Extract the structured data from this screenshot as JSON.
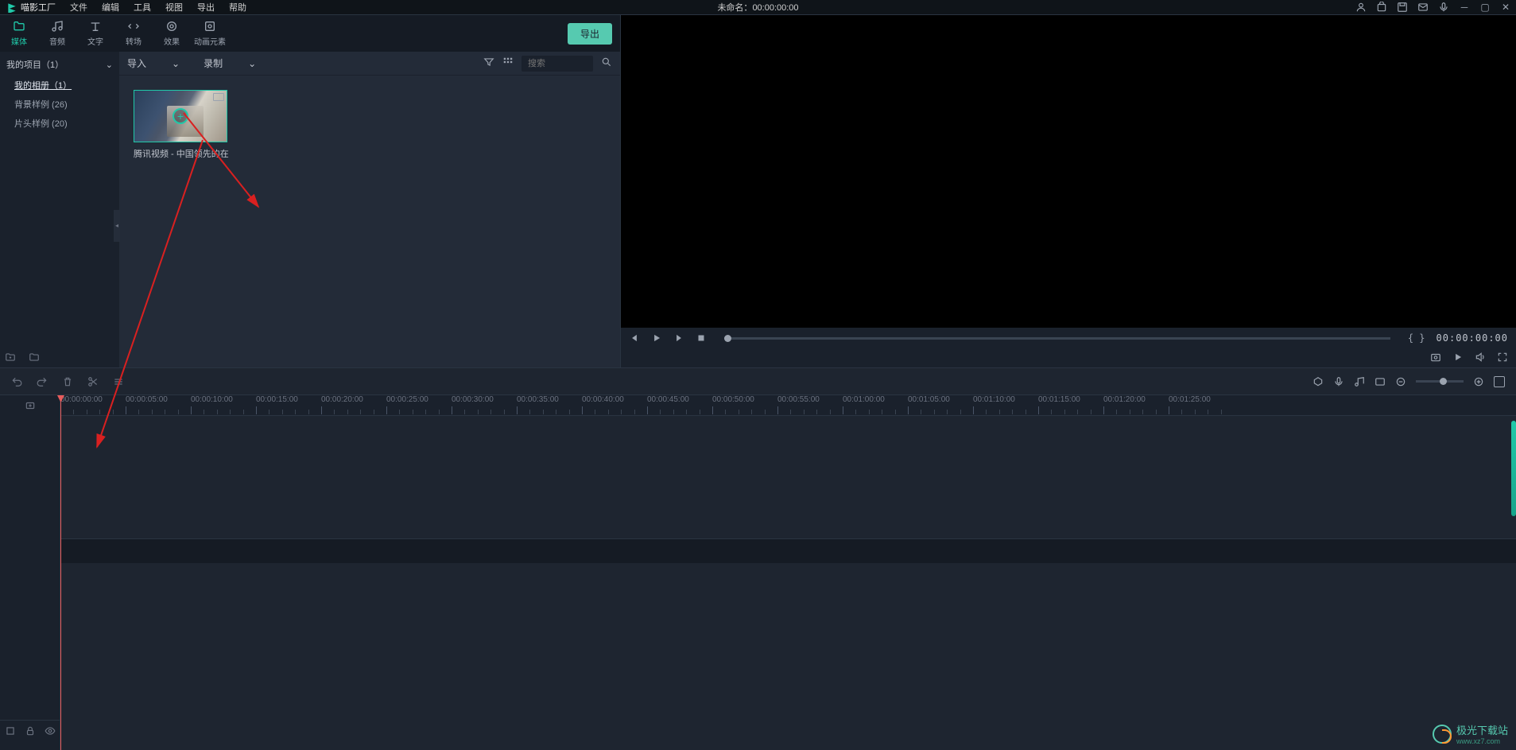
{
  "app": {
    "name": "喵影工厂"
  },
  "menubar": [
    "文件",
    "编辑",
    "工具",
    "视图",
    "导出",
    "帮助"
  ],
  "title_center": {
    "doc": "未命名：",
    "time": "00:00:00:00"
  },
  "tabs": {
    "media": "媒体",
    "audio": "音频",
    "text": "文字",
    "transition": "转场",
    "effect": "效果",
    "element": "动画元素"
  },
  "export_label": "导出",
  "sidebar": {
    "project_header": "我的项目（1）",
    "items": [
      {
        "label": "我的相册（1）",
        "active": true
      },
      {
        "label": "背景样例  (26)",
        "active": false
      },
      {
        "label": "片头样例  (20)",
        "active": false
      }
    ]
  },
  "browser": {
    "import_label": "导入",
    "record_label": "录制",
    "search_placeholder": "搜索"
  },
  "media_clip": {
    "label": "腾讯视频 - 中国领先的在"
  },
  "preview": {
    "time": "00:00:00:00",
    "markers": "{  }"
  },
  "ruler_labels": [
    "00:00:00:00",
    "00:00:05:00",
    "00:00:10:00",
    "00:00:15:00",
    "00:00:20:00",
    "00:00:25:00",
    "00:00:30:00",
    "00:00:35:00",
    "00:00:40:00",
    "00:00:45:00",
    "00:00:50:00",
    "00:00:55:00",
    "00:01:00:00",
    "00:01:05:00",
    "00:01:10:00",
    "00:01:15:00",
    "00:01:20:00",
    "00:01:25:00"
  ],
  "watermark": {
    "name": "极光下载站",
    "url": "www.xz7.com"
  }
}
